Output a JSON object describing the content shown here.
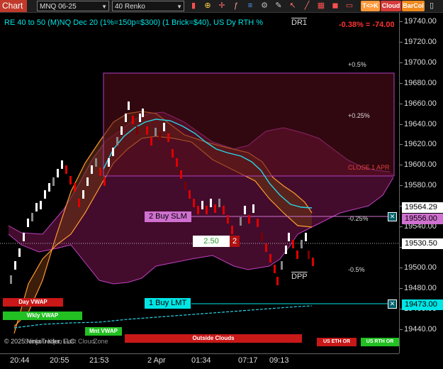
{
  "toolbar": {
    "chart_tab": "Chart",
    "instrument": "MNQ 06-25",
    "bar_type": "40 Renko",
    "btn_tk": "T<>K",
    "btn_cloud": "Cloud",
    "btn_barcol": "BarCol"
  },
  "header": {
    "description": "RE 40 to 50 (M)NQ Dec 20 (1%=150p=$300) (1 Brick=$40), US Dy RTH %",
    "pnl": "-0.38% = -74.00"
  },
  "levels": {
    "dr1": "DR1",
    "dpp": "DPP",
    "p05": "+0.5%",
    "p025": "+0.25%",
    "close": "CLOSE 1 APR",
    "m025": "-0.25%",
    "m05": "-0.5%"
  },
  "orders": {
    "buy_slm": "2 Buy SLM",
    "buy_lmt": "1 Buy LMT",
    "entry_price": "2.50",
    "entry_qty": "2"
  },
  "indicators": {
    "day_vwap": "Day VWAP",
    "wkly_vwap": "Wkly VWAP",
    "mnt_vwap": "Mnt VWAP",
    "outside_clouds": "Outside Clouds",
    "us_eth_or": "US ETH OR",
    "us_rth_or": "US RTH OR",
    "copyright": "© 2025 NinjaTrader, LLC",
    "clouds_label": "Senkou-Kijun Fast Cloud",
    "zone_label": "Zone"
  },
  "price_axis": {
    "ticks": [
      "19740.00",
      "19720.00",
      "19700.00",
      "19680.00",
      "19660.00",
      "19640.00",
      "19620.00",
      "19600.00",
      "19580.00",
      "19560.00",
      "19540.00",
      "19520.00",
      "19500.00",
      "19480.00",
      "19460.00",
      "19440.00"
    ],
    "last_price": "19564.29",
    "slm_price": "19556.00",
    "crosshair_price": "19530.50",
    "lmt_price": "19473.00"
  },
  "time_axis": {
    "ticks": [
      "20:44",
      "20:55",
      "21:53",
      "2 Apr",
      "01:34",
      "07:17",
      "09:13"
    ]
  },
  "colors": {
    "accent_cyan": "#00e5e5",
    "brick_up": "#ffffff",
    "brick_down": "#e00000",
    "cloud_magenta": "#c040c0",
    "cloud_orange": "#ff9933",
    "order_lmt": "#00e5e5",
    "order_slm": "#d070d0"
  }
}
